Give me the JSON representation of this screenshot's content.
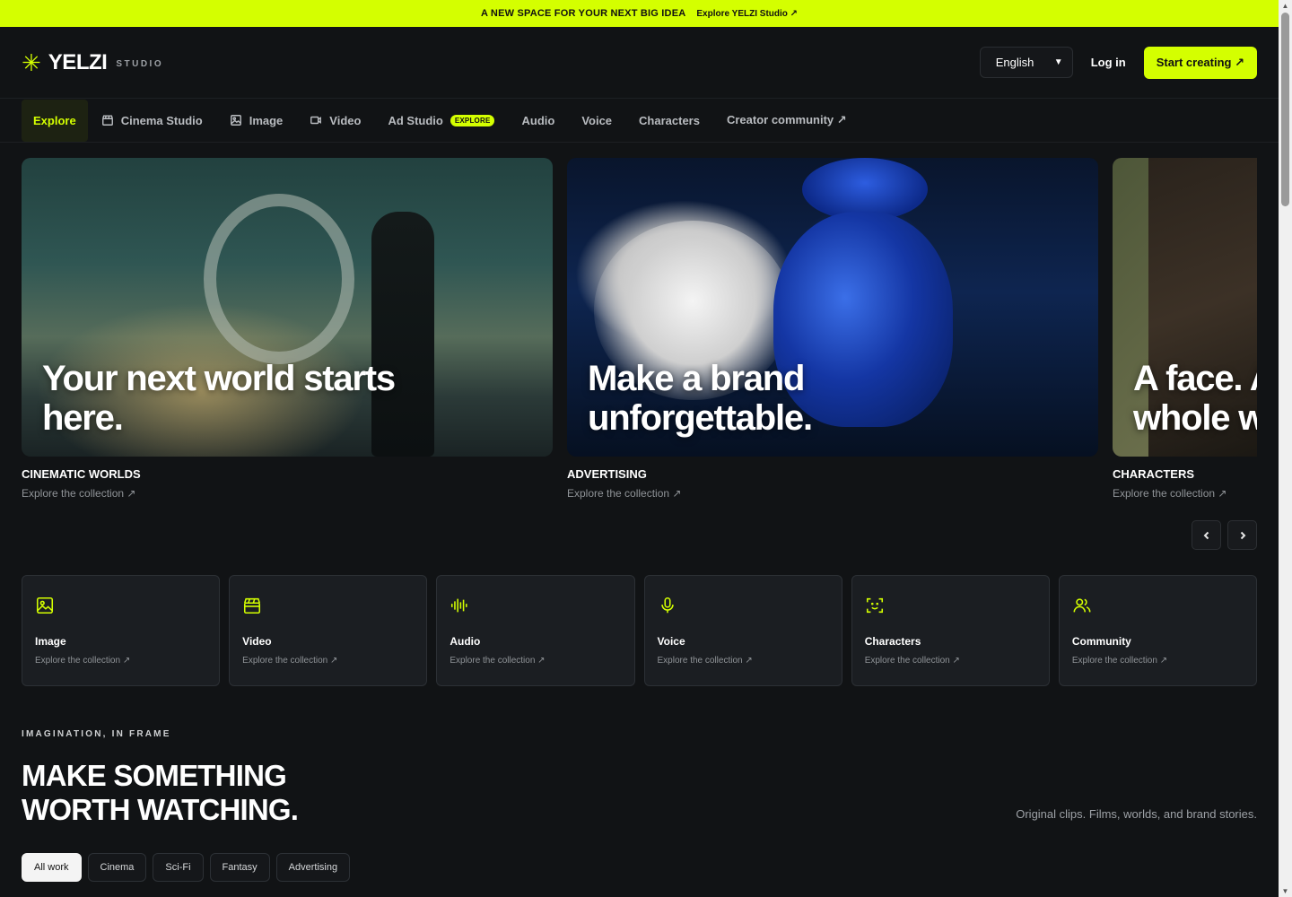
{
  "banner": {
    "text": "A NEW SPACE FOR YOUR NEXT BIG IDEA",
    "link": "Explore YELZI Studio ↗"
  },
  "header": {
    "logo_mark": "✳",
    "logo_name": "YELZI",
    "logo_sub": "STUDIO",
    "language": "English",
    "login": "Log in",
    "cta": "Start creating ↗"
  },
  "nav": {
    "items": [
      {
        "label": "Explore"
      },
      {
        "label": "Cinema Studio",
        "icon": "clapperboard-icon"
      },
      {
        "label": "Image",
        "icon": "image-icon"
      },
      {
        "label": "Video",
        "icon": "video-icon"
      },
      {
        "label": "Ad Studio",
        "badge": "EXPLORE"
      },
      {
        "label": "Audio"
      },
      {
        "label": "Voice"
      },
      {
        "label": "Characters"
      },
      {
        "label": "Creator community ↗"
      }
    ]
  },
  "carousel": {
    "slides": [
      {
        "title": "Your next world starts\nhere.",
        "label": "CINEMATIC WORLDS",
        "link": "Explore the collection ↗"
      },
      {
        "title": "Make a brand\nunforgettable.",
        "label": "ADVERTISING",
        "link": "Explore the collection ↗"
      },
      {
        "title": "A face. A\nwhole world.",
        "label": "CHARACTERS",
        "link": "Explore the collection ↗"
      }
    ]
  },
  "categories": [
    {
      "title": "Image",
      "link": "Explore the collection ↗",
      "icon": "image-icon"
    },
    {
      "title": "Video",
      "link": "Explore the collection ↗",
      "icon": "clapperboard-icon"
    },
    {
      "title": "Audio",
      "link": "Explore the collection ↗",
      "icon": "waveform-icon"
    },
    {
      "title": "Voice",
      "link": "Explore the collection ↗",
      "icon": "microphone-icon"
    },
    {
      "title": "Characters",
      "link": "Explore the collection ↗",
      "icon": "face-scan-icon"
    },
    {
      "title": "Community",
      "link": "Explore the collection ↗",
      "icon": "users-icon"
    }
  ],
  "section": {
    "eyebrow": "IMAGINATION, IN FRAME",
    "title": "MAKE SOMETHING\nWORTH WATCHING.",
    "description": "Original clips. Films, worlds, and brand stories.",
    "filters": [
      "All work",
      "Cinema",
      "Sci-Fi",
      "Fantasy",
      "Advertising"
    ]
  },
  "colors": {
    "accent": "#d4ff00",
    "background": "#111315",
    "card": "#1b1e22"
  }
}
